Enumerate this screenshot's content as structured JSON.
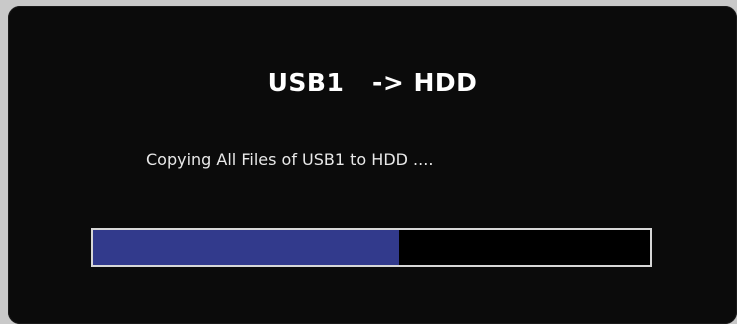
{
  "dialog": {
    "title": "USB1   -> HDD",
    "message": "Copying All Files of USB1 to HDD ....",
    "progress": {
      "value": 0.55
    }
  },
  "colors": {
    "background": "#0b0b0b",
    "progress_fill": "#323a8c",
    "progress_border": "#d7d7d7",
    "text": "#ffffff"
  }
}
